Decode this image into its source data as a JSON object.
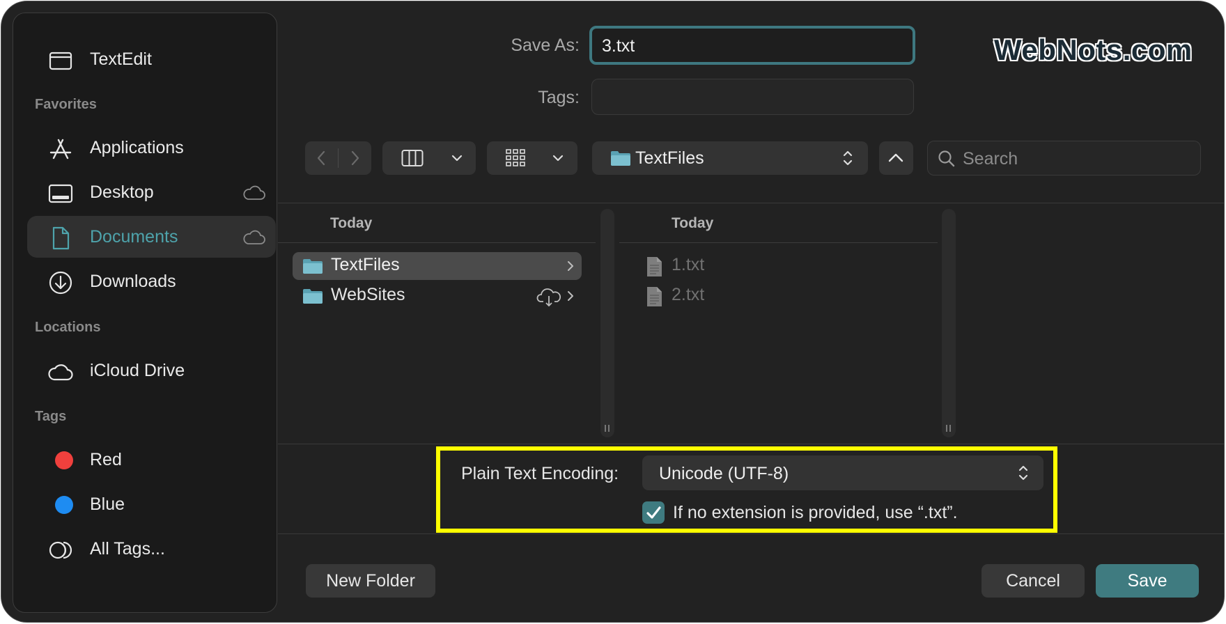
{
  "sidebar": {
    "app_item": {
      "label": "TextEdit",
      "icon": "window-icon"
    },
    "favorites_heading": "Favorites",
    "favorites": [
      {
        "label": "Applications",
        "icon": "applications-icon"
      },
      {
        "label": "Desktop",
        "icon": "desktop-icon",
        "cloud": true
      },
      {
        "label": "Documents",
        "icon": "document-icon",
        "cloud": true,
        "selected": true
      },
      {
        "label": "Downloads",
        "icon": "download-icon"
      }
    ],
    "locations_heading": "Locations",
    "locations": [
      {
        "label": "iCloud Drive",
        "icon": "cloud-icon"
      }
    ],
    "tags_heading": "Tags",
    "tags": [
      {
        "label": "Red",
        "color": "#f0403d"
      },
      {
        "label": "Blue",
        "color": "#1e8cf2"
      },
      {
        "label": "All Tags...",
        "icon": "all-tags-icon"
      }
    ]
  },
  "form": {
    "save_as_label": "Save As:",
    "save_as_value": "3.txt",
    "tags_label": "Tags:",
    "tags_value": ""
  },
  "toolbar": {
    "location": "TextFiles",
    "search_placeholder": "Search"
  },
  "browser": {
    "column1": {
      "heading": "Today",
      "items": [
        {
          "label": "TextFiles",
          "selected": true
        },
        {
          "label": "WebSites",
          "cloud": true
        }
      ]
    },
    "column2": {
      "heading": "Today",
      "items": [
        {
          "label": "1.txt"
        },
        {
          "label": "2.txt"
        }
      ]
    }
  },
  "options": {
    "encoding_label": "Plain Text Encoding:",
    "encoding_value": "Unicode (UTF-8)",
    "extension_checkbox": "If no extension is provided, use “.txt”.",
    "extension_checked": true
  },
  "buttons": {
    "new_folder": "New Folder",
    "cancel": "Cancel",
    "save": "Save"
  },
  "watermark": "WebNots.com",
  "colors": {
    "accent": "#3f7b80",
    "highlight": "#ffff00",
    "selected_text": "#4ea3ab"
  }
}
